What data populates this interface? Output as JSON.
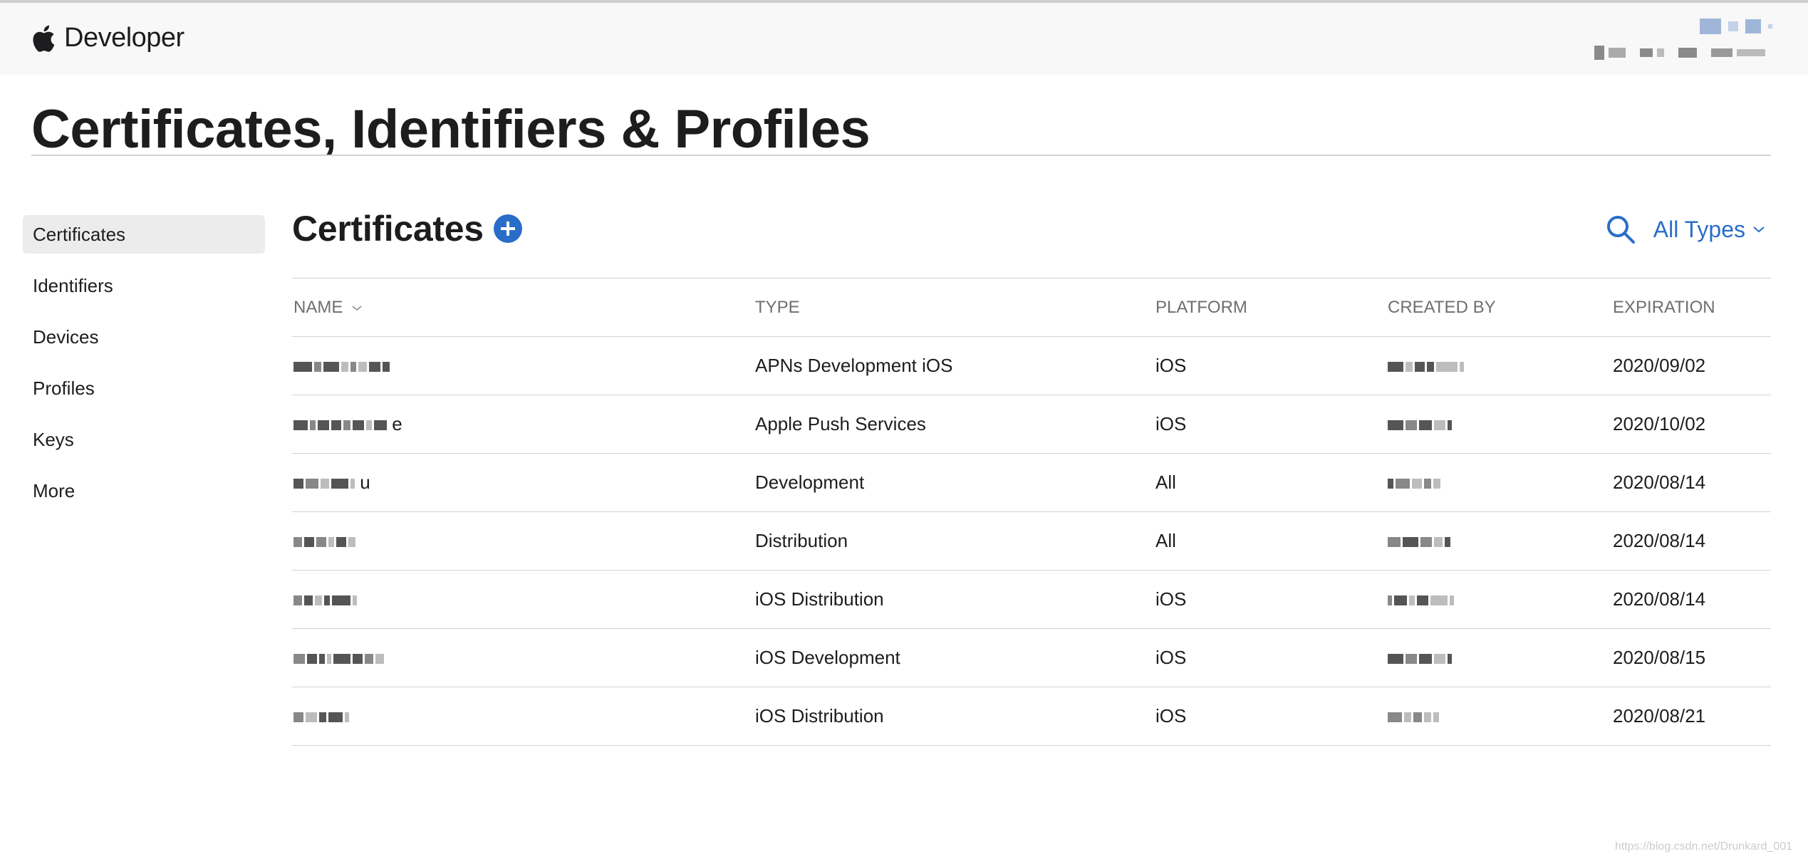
{
  "header": {
    "brand": "Developer"
  },
  "page_title": "Certificates, Identifiers & Profiles",
  "sidebar": {
    "items": [
      {
        "label": "Certificates",
        "active": true
      },
      {
        "label": "Identifiers",
        "active": false
      },
      {
        "label": "Devices",
        "active": false
      },
      {
        "label": "Profiles",
        "active": false
      },
      {
        "label": "Keys",
        "active": false
      },
      {
        "label": "More",
        "active": false
      }
    ]
  },
  "section": {
    "title": "Certificates",
    "filter_label": "All Types"
  },
  "table": {
    "columns": {
      "name": "NAME",
      "type": "TYPE",
      "platform": "PLATFORM",
      "created_by": "CREATED BY",
      "expiration": "EXPIRATION"
    },
    "rows": [
      {
        "name_suffix": "",
        "type": "APNs Development iOS",
        "platform": "iOS",
        "expiration": "2020/09/02"
      },
      {
        "name_suffix": "e",
        "type": "Apple Push Services",
        "platform": "iOS",
        "expiration": "2020/10/02"
      },
      {
        "name_suffix": "u",
        "type": "Development",
        "platform": "All",
        "expiration": "2020/08/14"
      },
      {
        "name_suffix": "",
        "type": "Distribution",
        "platform": "All",
        "expiration": "2020/08/14"
      },
      {
        "name_suffix": "",
        "type": "iOS Distribution",
        "platform": "iOS",
        "expiration": "2020/08/14"
      },
      {
        "name_suffix": "",
        "type": "iOS Development",
        "platform": "iOS",
        "expiration": "2020/08/15"
      },
      {
        "name_suffix": "",
        "type": "iOS Distribution",
        "platform": "iOS",
        "expiration": "2020/08/21"
      }
    ]
  },
  "watermark": "https://blog.csdn.net/Drunkard_001",
  "colors": {
    "accent": "#2a6dc8",
    "header_bg": "#f8f8f8",
    "active_item_bg": "#ececec",
    "divider": "#d2d2d7"
  }
}
